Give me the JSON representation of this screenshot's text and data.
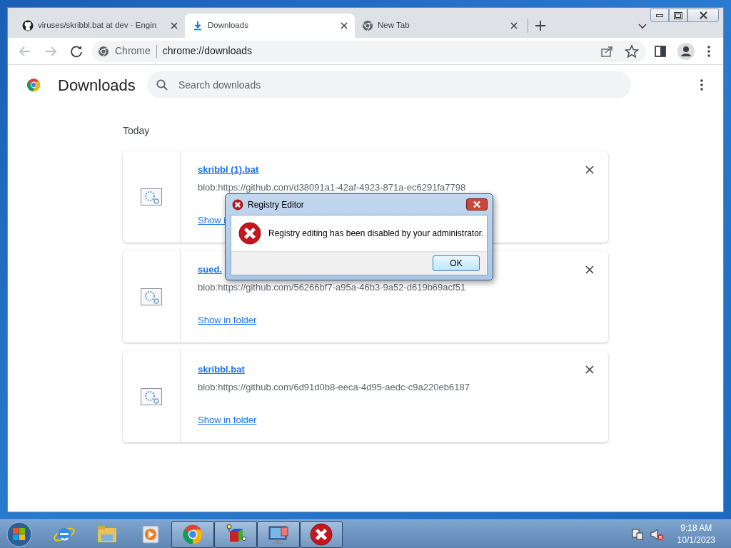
{
  "browser": {
    "tabs": [
      {
        "kind": "github",
        "title": "viruses/skribbl.bat at dev · Engin",
        "selected": false
      },
      {
        "kind": "download",
        "title": "Downloads",
        "selected": true
      },
      {
        "kind": "chrome",
        "title": "New Tab",
        "selected": false
      }
    ],
    "address_bar": {
      "site_label": "Chrome",
      "url": "chrome://downloads"
    }
  },
  "page": {
    "title": "Downloads",
    "search": {
      "placeholder": "Search downloads"
    },
    "section": "Today",
    "downloads": [
      {
        "file": "skribbl (1).bat",
        "url": "blob:https://github.com/d38091a1-42af-4923-871a-ec6291fa7798",
        "action": "Show i"
      },
      {
        "file": "sued.",
        "url": "blob:https://github.com/56266bf7-a95a-46b3-9a52-d619b69acf51",
        "action": "Show in folder"
      },
      {
        "file": "skribbl.bat",
        "url": "blob:https://github.com/6d91d0b8-eeca-4d95-aedc-c9a220eb6187",
        "action": "Show in folder"
      }
    ]
  },
  "dialog": {
    "title": "Registry Editor",
    "message": "Registry editing has been disabled by your administrator.",
    "button": "OK"
  },
  "taskbar": {
    "items": [
      {
        "kind": "ie",
        "running": false
      },
      {
        "kind": "folder",
        "running": false
      },
      {
        "kind": "media",
        "running": false
      },
      {
        "kind": "chrome",
        "running": true
      },
      {
        "kind": "cube",
        "running": true
      },
      {
        "kind": "monitor",
        "running": true
      },
      {
        "kind": "error",
        "running": true
      }
    ],
    "clock": {
      "time": "9:18 AM",
      "date": "10/1/2023"
    }
  }
}
